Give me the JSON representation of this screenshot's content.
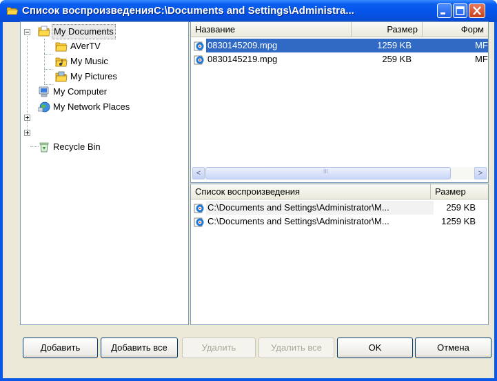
{
  "window": {
    "title": "Список воспроизведенияC:\\Documents and Settings\\Administra...",
    "accent": "#0a57e8"
  },
  "tree": {
    "items": [
      {
        "label": "My Documents",
        "icon": "documents-folder-icon",
        "expander": "minus"
      },
      {
        "label": "AVerTV",
        "icon": "folder-icon"
      },
      {
        "label": "My Music",
        "icon": "music-folder-icon"
      },
      {
        "label": "My Pictures",
        "icon": "pictures-folder-icon"
      },
      {
        "label": "My Computer",
        "icon": "computer-icon",
        "expander": "plus"
      },
      {
        "label": "My Network Places",
        "icon": "network-places-icon",
        "expander": "plus"
      },
      {
        "label": "Recycle Bin",
        "icon": "recycle-bin-icon"
      }
    ]
  },
  "files": {
    "columns": [
      "Название",
      "Размер",
      "Форм"
    ],
    "rows": [
      {
        "name": "0830145209.mpg",
        "size": "1259 KB",
        "format": "MF",
        "selected": true
      },
      {
        "name": "0830145219.mpg",
        "size": "259 KB",
        "format": "MF",
        "selected": false
      }
    ]
  },
  "playlist": {
    "columns": [
      "Список воспроизведения",
      "Размер"
    ],
    "rows": [
      {
        "path": "C:\\Documents and Settings\\Administrator\\M...",
        "size": "259 KB"
      },
      {
        "path": "C:\\Documents and Settings\\Administrator\\M...",
        "size": "1259 KB"
      }
    ]
  },
  "buttons": {
    "add": "Добавить",
    "add_all": "Добавить все",
    "remove": "Удалить",
    "remove_all": "Удалить все",
    "ok": "OK",
    "cancel": "Отмена"
  },
  "scroll": {
    "left_glyph": "<",
    "right_glyph": ">",
    "grip": "III"
  }
}
